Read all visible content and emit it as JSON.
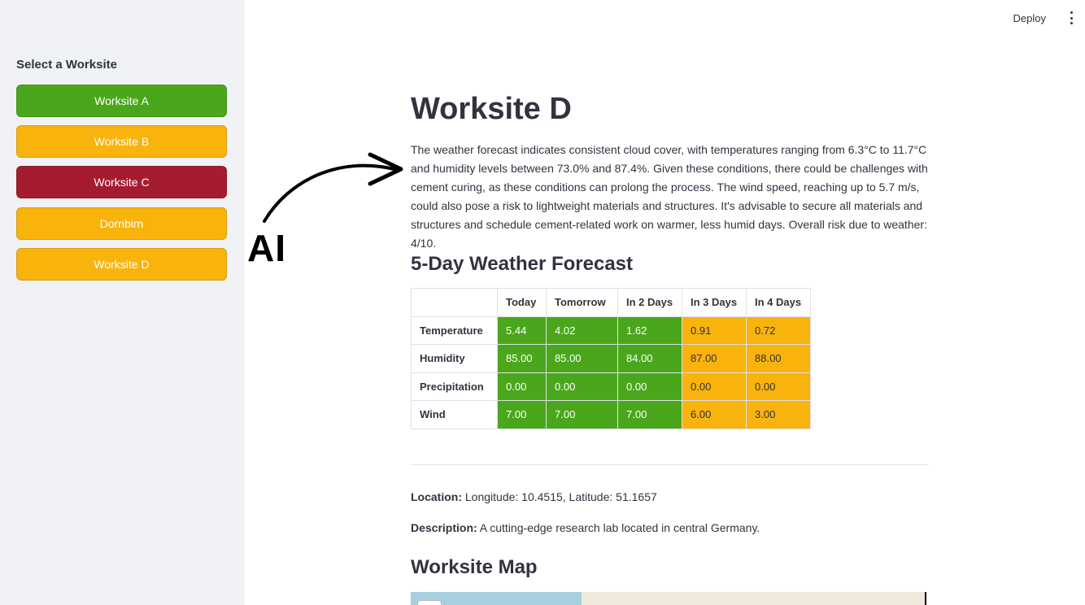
{
  "sidebar": {
    "title": "Select a Worksite",
    "buttons": [
      {
        "label": "Worksite A",
        "color": "#4aa71c"
      },
      {
        "label": "Worksite B",
        "color": "#f8b30d"
      },
      {
        "label": "Worksite C",
        "color": "#a51c30"
      },
      {
        "label": "Dornbirn",
        "color": "#f8b30d"
      },
      {
        "label": "Worksite D",
        "color": "#f8b30d"
      }
    ]
  },
  "topbar": {
    "deploy_label": "Deploy",
    "menu_icon": "kebab-menu-icon"
  },
  "overlay": {
    "ai_label": "AI",
    "arrow_icon": "curved-arrow-icon"
  },
  "main": {
    "title": "Worksite D",
    "summary": "The weather forecast indicates consistent cloud cover, with temperatures ranging from 6.3°C to 11.7°C and humidity levels between 73.0% and 87.4%. Given these conditions, there could be challenges with cement curing, as these conditions can prolong the process. The wind speed, reaching up to 5.7 m/s, could also pose a risk to lightweight materials and structures. It's advisable to secure all materials and structures and schedule cement-related work on warmer, less humid days. Overall risk due to weather: 4/10.",
    "forecast_heading": "5-Day Weather Forecast",
    "forecast": {
      "columns": [
        "Today",
        "Tomorrow",
        "In 2 Days",
        "In 3 Days",
        "In 4 Days"
      ],
      "rows": [
        {
          "label": "Temperature",
          "values": [
            "5.44",
            "4.02",
            "1.62",
            "0.91",
            "0.72"
          ]
        },
        {
          "label": "Humidity",
          "values": [
            "85.00",
            "85.00",
            "84.00",
            "87.00",
            "88.00"
          ]
        },
        {
          "label": "Precipitation",
          "values": [
            "0.00",
            "0.00",
            "0.00",
            "0.00",
            "0.00"
          ]
        },
        {
          "label": "Wind",
          "values": [
            "7.00",
            "7.00",
            "7.00",
            "6.00",
            "3.00"
          ]
        }
      ],
      "column_colors": [
        "#4aa71c",
        "#4aa71c",
        "#4aa71c",
        "#f8b30d",
        "#f8b30d"
      ]
    },
    "location_label": "Location:",
    "location_value": " Longitude: 10.4515, Latitude: 51.1657",
    "description_label": "Description:",
    "description_value": " A cutting-edge research lab located in central Germany.",
    "map_heading": "Worksite Map"
  }
}
